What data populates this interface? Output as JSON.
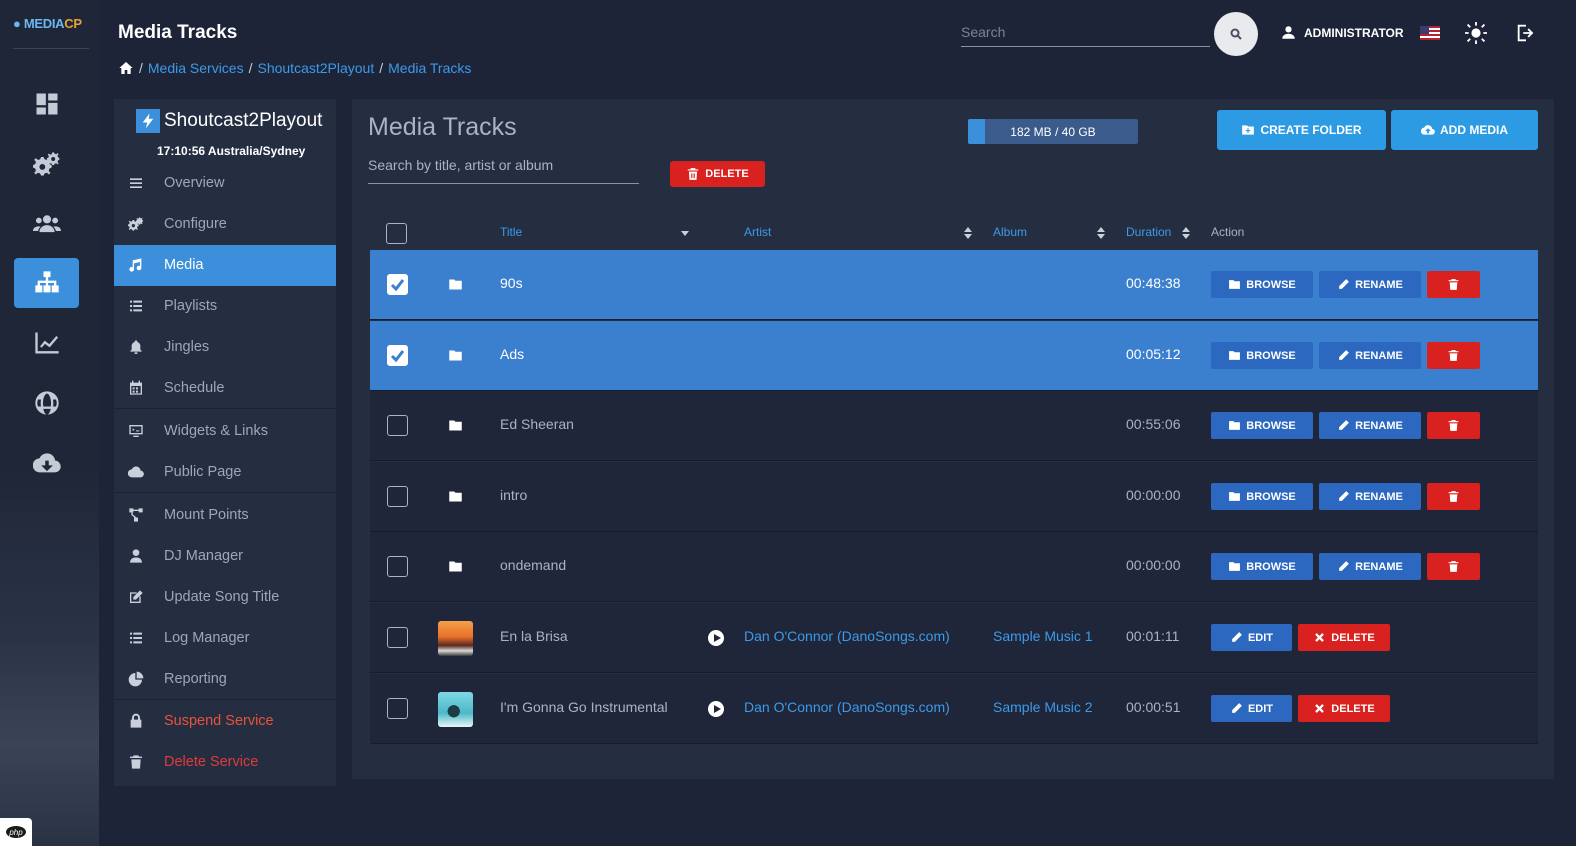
{
  "app": {
    "logo_main": "MEDIA",
    "logo_accent": "CP",
    "page_title": "Media Tracks",
    "search_placeholder": "Search",
    "user_label": "ADMINISTRATOR",
    "php_badge": "php"
  },
  "breadcrumb": [
    {
      "label": "Media Services"
    },
    {
      "label": "Shoutcast2Playout"
    },
    {
      "label": "Media Tracks"
    }
  ],
  "service": {
    "name": "Shoutcast2Playout",
    "time": "17:10:56 Australia/Sydney",
    "menu": [
      {
        "label": "Overview",
        "icon": "bars-icon"
      },
      {
        "label": "Configure",
        "icon": "gears-icon"
      },
      {
        "label": "Media",
        "icon": "music-icon",
        "active": true
      },
      {
        "label": "Playlists",
        "icon": "list-icon"
      },
      {
        "label": "Jingles",
        "icon": "bell-icon"
      },
      {
        "label": "Schedule",
        "icon": "calendar-icon"
      },
      {
        "label": "Widgets & Links",
        "icon": "monitor-icon"
      },
      {
        "label": "Public Page",
        "icon": "cloud-icon"
      },
      {
        "label": "Mount Points",
        "icon": "network-icon"
      },
      {
        "label": "DJ Manager",
        "icon": "user-icon"
      },
      {
        "label": "Update Song Title",
        "icon": "edit-icon"
      },
      {
        "label": "Log Manager",
        "icon": "list-icon"
      },
      {
        "label": "Reporting",
        "icon": "pie-chart-icon"
      },
      {
        "label": "Suspend Service",
        "icon": "lock-icon",
        "danger": true
      },
      {
        "label": "Delete Service",
        "icon": "trash-icon",
        "danger": true
      }
    ]
  },
  "main": {
    "title": "Media Tracks",
    "quota_label": "182 MB / 40 GB",
    "quota_fraction": 0.005,
    "create_folder_label": "CREATE FOLDER",
    "add_media_label": "ADD MEDIA",
    "filter_placeholder": "Search by title, artist or album",
    "delete_label": "DELETE",
    "columns": {
      "title": "Title",
      "artist": "Artist",
      "album": "Album",
      "duration": "Duration",
      "action": "Action"
    },
    "rows": [
      {
        "type": "folder",
        "title": "90s",
        "duration": "00:48:38",
        "checked": true
      },
      {
        "type": "folder",
        "title": "Ads",
        "duration": "00:05:12",
        "checked": true
      },
      {
        "type": "folder",
        "title": "Ed Sheeran",
        "duration": "00:55:06",
        "checked": false
      },
      {
        "type": "folder",
        "title": "intro",
        "duration": "00:00:00",
        "checked": false
      },
      {
        "type": "folder",
        "title": "ondemand",
        "duration": "00:00:00",
        "checked": false
      },
      {
        "type": "track",
        "title": "En la Brisa",
        "artist": "Dan O'Connor (DanoSongs.com)",
        "album": "Sample Music 1",
        "duration": "00:01:11",
        "checked": false
      },
      {
        "type": "track",
        "title": "I'm Gonna Go Instrumental",
        "artist": "Dan O'Connor (DanoSongs.com)",
        "album": "Sample Music 2",
        "duration": "00:00:51",
        "checked": false
      }
    ],
    "row_actions": {
      "browse": "BROWSE",
      "rename": "RENAME",
      "edit": "EDIT",
      "delete": "DELETE"
    }
  },
  "colors": {
    "accent": "#3b8fdb",
    "danger": "#d9211f",
    "selected_row": "#3b7fcf"
  }
}
